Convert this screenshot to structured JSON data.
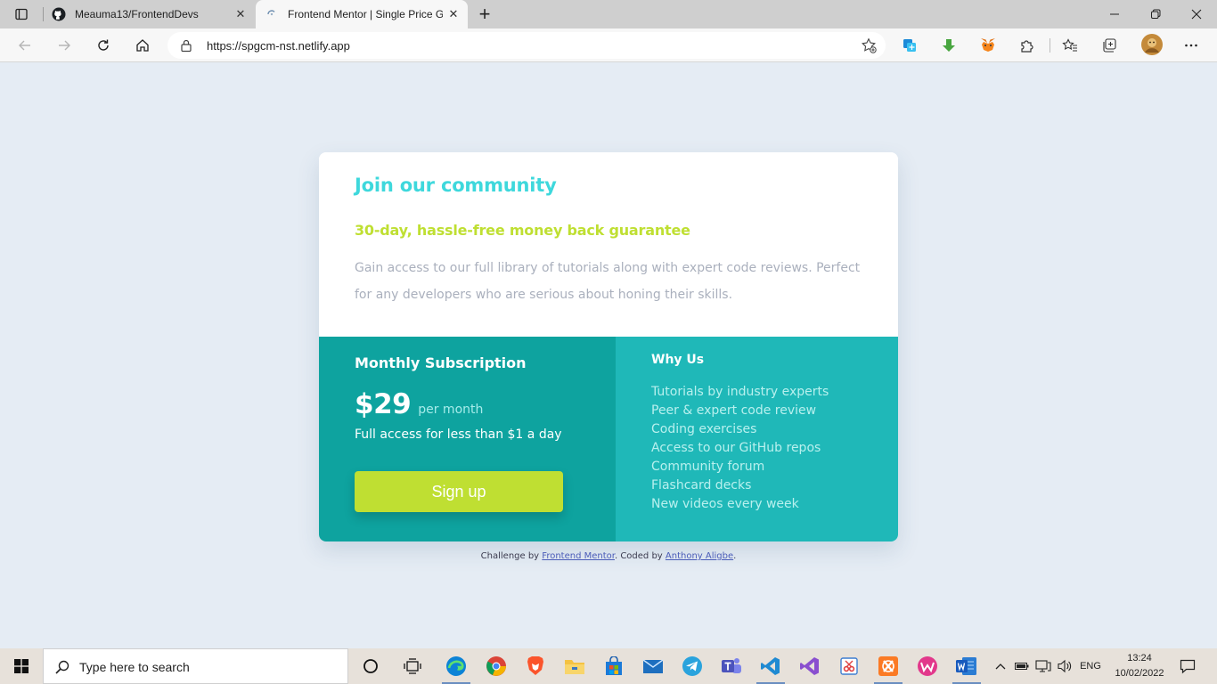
{
  "browser": {
    "tabs": [
      {
        "title": "Meauma13/FrontendDevs",
        "icon": "github-icon"
      },
      {
        "title": "Frontend Mentor | Single Price G",
        "icon": "frontend-mentor-icon"
      }
    ],
    "url": "https://spgcm-nst.netlify.app"
  },
  "card": {
    "heading": "Join our community",
    "subheading": "30-day, hassle-free money back guarantee",
    "description": "Gain access to our full library of tutorials along with expert code reviews. Perfect for any developers who are serious about honing their skills.",
    "subscription": {
      "title": "Monthly Subscription",
      "price": "$29",
      "period": "per month",
      "access": "Full access for less than $1 a day",
      "button": "Sign up"
    },
    "why": {
      "title": "Why Us",
      "items": [
        "Tutorials by industry experts",
        "Peer & expert code review",
        "Coding exercises",
        "Access to our GitHub repos",
        "Community forum",
        "Flashcard decks",
        "New videos every week"
      ]
    }
  },
  "footer": {
    "prefix": "Challenge by",
    "link1": "Frontend Mentor",
    "middle": ". Coded by",
    "link2": "Anthony Aligbe",
    "suffix": "."
  },
  "taskbar": {
    "search_placeholder": "Type here to search",
    "language": "ENG",
    "time": "13:24",
    "date": "10/02/2022"
  },
  "colors": {
    "heading": "#3ed8dc",
    "accent": "#bfdf32",
    "left_panel": "#0ea39f",
    "right_panel": "#1fb8b8",
    "page_background": "#e5ecf4"
  }
}
